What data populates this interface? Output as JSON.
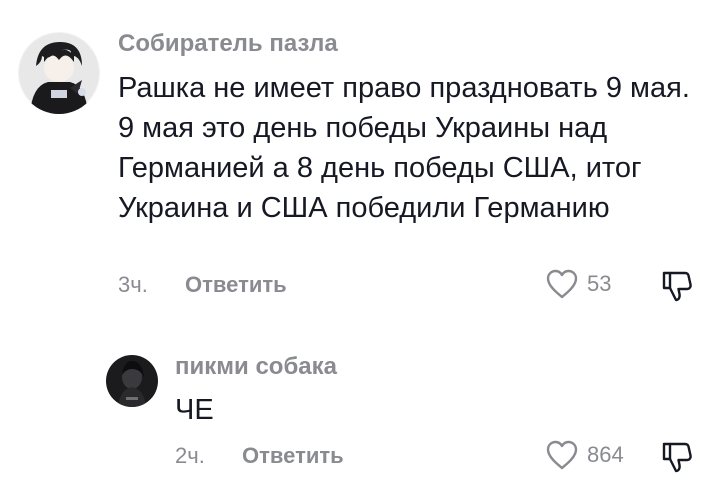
{
  "comments": [
    {
      "username": "Собиратель пазла",
      "text": "Рашка не имеет право праздновать 9 мая. 9 мая это день победы Украины над Германией а 8 день победы США, итог Украина и США победили Германию",
      "time": "3ч.",
      "reply_label": "Ответить",
      "likes": "53",
      "avatar_icon": "anime-character-avatar",
      "like_icon": "heart-outline-icon",
      "dislike_icon": "thumbs-down-outline-icon"
    },
    {
      "username": "пикми собака",
      "text": "ЧЕ",
      "time": "2ч.",
      "reply_label": "Ответить",
      "likes": "864",
      "avatar_icon": "dark-photo-avatar",
      "like_icon": "heart-outline-icon",
      "dislike_icon": "thumbs-down-outline-icon"
    }
  ],
  "colors": {
    "text": "#161823",
    "secondary": "#8a8b91",
    "background": "#ffffff"
  }
}
